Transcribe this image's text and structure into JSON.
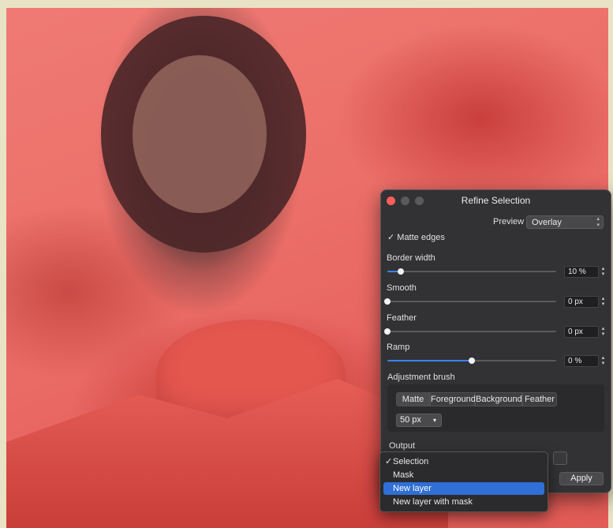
{
  "dialog": {
    "title": "Refine Selection",
    "preview_label": "Preview",
    "preview_value": "Overlay",
    "matte_edges_label": "Matte edges",
    "matte_edges_checked": true,
    "check_glyph": "✓"
  },
  "sliders": [
    {
      "label": "Border width",
      "value": "10 %",
      "level": 0.08
    },
    {
      "label": "Smooth",
      "value": "0 px",
      "level": 0.0
    },
    {
      "label": "Feather",
      "value": "0 px",
      "level": 0.0
    },
    {
      "label": "Ramp",
      "value": "0 %",
      "level": 0.5
    }
  ],
  "adjustment_brush": {
    "label": "Adjustment brush",
    "modes": [
      "Matte",
      "Foreground",
      "Background",
      "Feather"
    ],
    "active_mode": "Matte",
    "size_value": "50 px",
    "size_caret": "▾"
  },
  "output": {
    "label": "Output",
    "apply_label": "Apply",
    "menu_items": [
      "Selection",
      "Mask",
      "New layer",
      "New layer with mask"
    ],
    "checked_item": "Selection",
    "highlighted_item": "New layer"
  },
  "colors": {
    "overlay_red": "#ec6f69",
    "accent_blue": "#3b82f6",
    "menu_highlight": "#2f6fd6",
    "close_button": "#ff5f57"
  },
  "icons": {
    "updown": "⌃⌄"
  }
}
